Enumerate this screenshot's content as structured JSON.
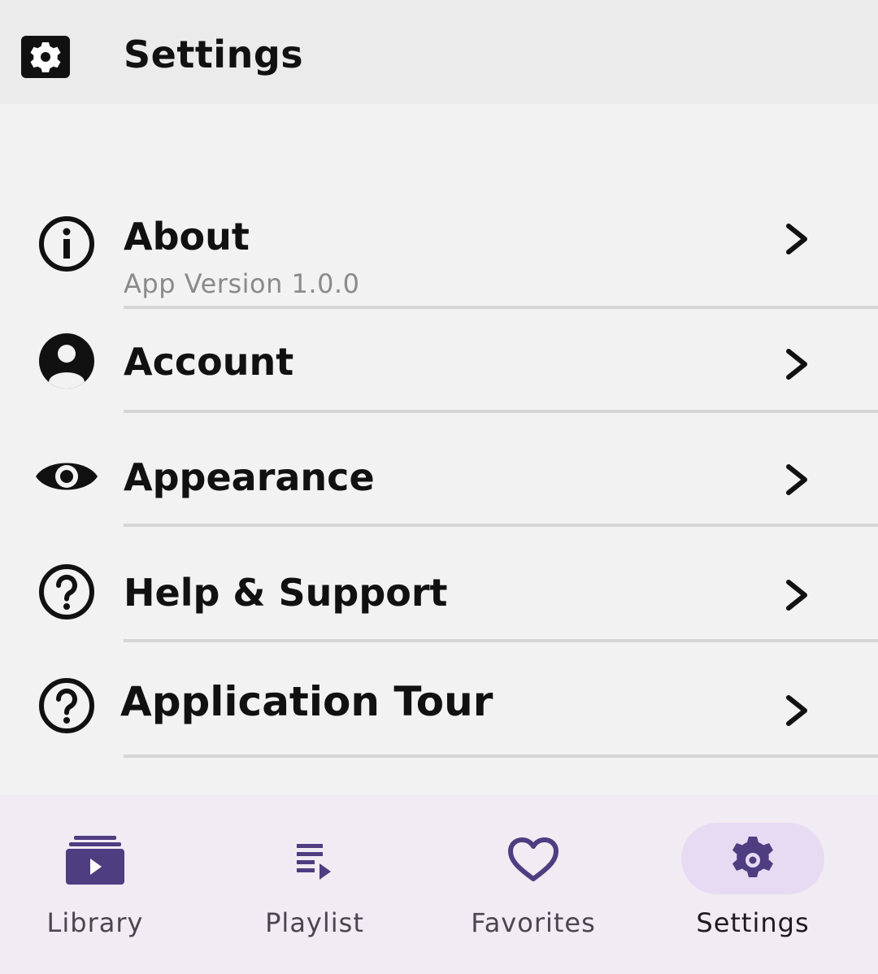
{
  "header": {
    "title": "Settings",
    "icon": "settings-icon"
  },
  "rows": [
    {
      "label": "About",
      "sublabel": "App Version 1.0.0",
      "icon": "info-icon"
    },
    {
      "label": "Account",
      "icon": "account-circle-icon"
    },
    {
      "label": "Appearance",
      "icon": "eye-icon"
    },
    {
      "label": "Help & Support",
      "icon": "help-circle-icon"
    },
    {
      "label": "Application Tour",
      "icon": "help-circle-icon"
    }
  ],
  "bottom_nav": {
    "items": [
      {
        "label": "Library",
        "icon": "library-icon",
        "active": false
      },
      {
        "label": "Playlist",
        "icon": "playlist-icon",
        "active": false
      },
      {
        "label": "Favorites",
        "icon": "heart-icon",
        "active": false
      },
      {
        "label": "Settings",
        "icon": "gear-icon",
        "active": true
      }
    ]
  },
  "colors": {
    "accent": "#4e3d80",
    "nav_background": "#f1ebf3",
    "active_pill": "#e7dbf3"
  }
}
